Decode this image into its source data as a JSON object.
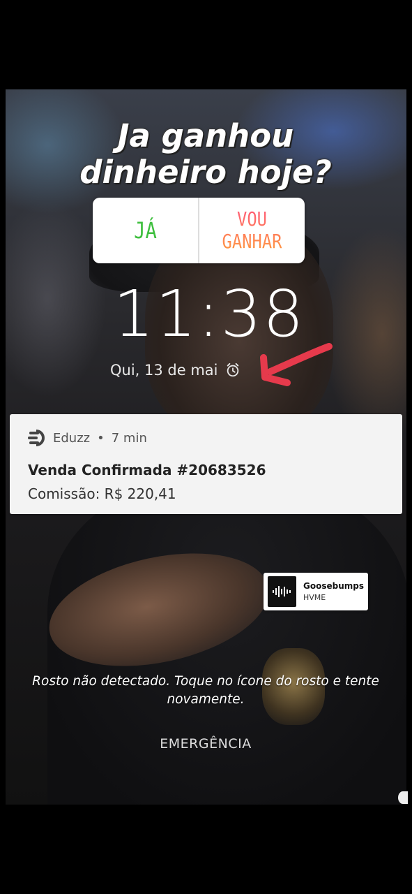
{
  "story": {
    "headline_line1": "Ja ganhou",
    "headline_line2": "dinheiro hoje?",
    "poll": {
      "option_yes": "JÁ",
      "option_no_line1": "VOU",
      "option_no_line2": "GANHAR"
    },
    "music_sticker": {
      "title": "Goosebumps",
      "artist": "HVME",
      "icon": "sound-wave-icon"
    },
    "arrow_color": "#e63a4c"
  },
  "lockscreen": {
    "time": "11:38",
    "date": "Qui, 13 de mai",
    "alarm_icon": "alarm-clock-icon",
    "notification": {
      "app_name": "Eduzz",
      "separator": "•",
      "age": "7 min",
      "title": "Venda Confirmada #20683526",
      "body": "Comissão: R$ 220,41"
    },
    "face_message": "Rosto não detectado. Toque no ícone do rosto e tente novamente.",
    "emergency_label": "EMERGÊNCIA"
  },
  "colors": {
    "poll_yes": "#3fbf3f",
    "poll_no_start": "#ff5a78",
    "poll_no_end": "#ff9a40"
  }
}
